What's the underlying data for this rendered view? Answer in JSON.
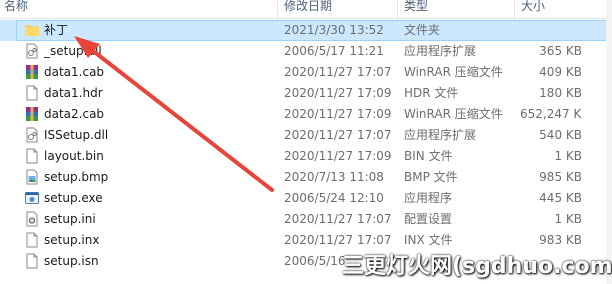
{
  "columns": {
    "name": "名称",
    "date": "修改日期",
    "type": "类型",
    "size": "大小"
  },
  "files": [
    {
      "name": "补丁",
      "date": "2021/3/30 13:52",
      "type": "文件夹",
      "size": "",
      "icon": "folder-icon",
      "selected": true
    },
    {
      "name": "_setup.dll",
      "date": "2006/5/17 11:21",
      "type": "应用程序扩展",
      "size": "365 KB",
      "icon": "dll-icon"
    },
    {
      "name": "data1.cab",
      "date": "2020/11/27 17:07",
      "type": "WinRAR 压缩文件",
      "size": "409 KB",
      "icon": "winrar-icon"
    },
    {
      "name": "data1.hdr",
      "date": "2020/11/27 17:09",
      "type": "HDR 文件",
      "size": "180 KB",
      "icon": "file-icon"
    },
    {
      "name": "data2.cab",
      "date": "2020/11/27 17:09",
      "type": "WinRAR 压缩文件",
      "size": "652,247 KB",
      "icon": "winrar-icon"
    },
    {
      "name": "ISSetup.dll",
      "date": "2020/11/27 17:07",
      "type": "应用程序扩展",
      "size": "540 KB",
      "icon": "dll-icon"
    },
    {
      "name": "layout.bin",
      "date": "2020/11/27 17:09",
      "type": "BIN 文件",
      "size": "1 KB",
      "icon": "file-icon"
    },
    {
      "name": "setup.bmp",
      "date": "2020/7/13 11:08",
      "type": "BMP 文件",
      "size": "985 KB",
      "icon": "image-icon"
    },
    {
      "name": "setup.exe",
      "date": "2006/5/24 12:10",
      "type": "应用程序",
      "size": "445 KB",
      "icon": "exe-icon"
    },
    {
      "name": "setup.ini",
      "date": "2020/11/27 17:07",
      "type": "配置设置",
      "size": "1 KB",
      "icon": "ini-icon"
    },
    {
      "name": "setup.inx",
      "date": "2020/11/27 17:07",
      "type": "INX 文件",
      "size": "983 KB",
      "icon": "file-icon"
    },
    {
      "name": "setup.isn",
      "date": "2006/5/16",
      "type": "",
      "size": "",
      "icon": "file-icon"
    }
  ],
  "watermark": "三更灯火网(sgdhuo.com)",
  "colors": {
    "selection": "#cce8ff",
    "arrow": "#e8443a",
    "header_text": "#4c607a"
  }
}
